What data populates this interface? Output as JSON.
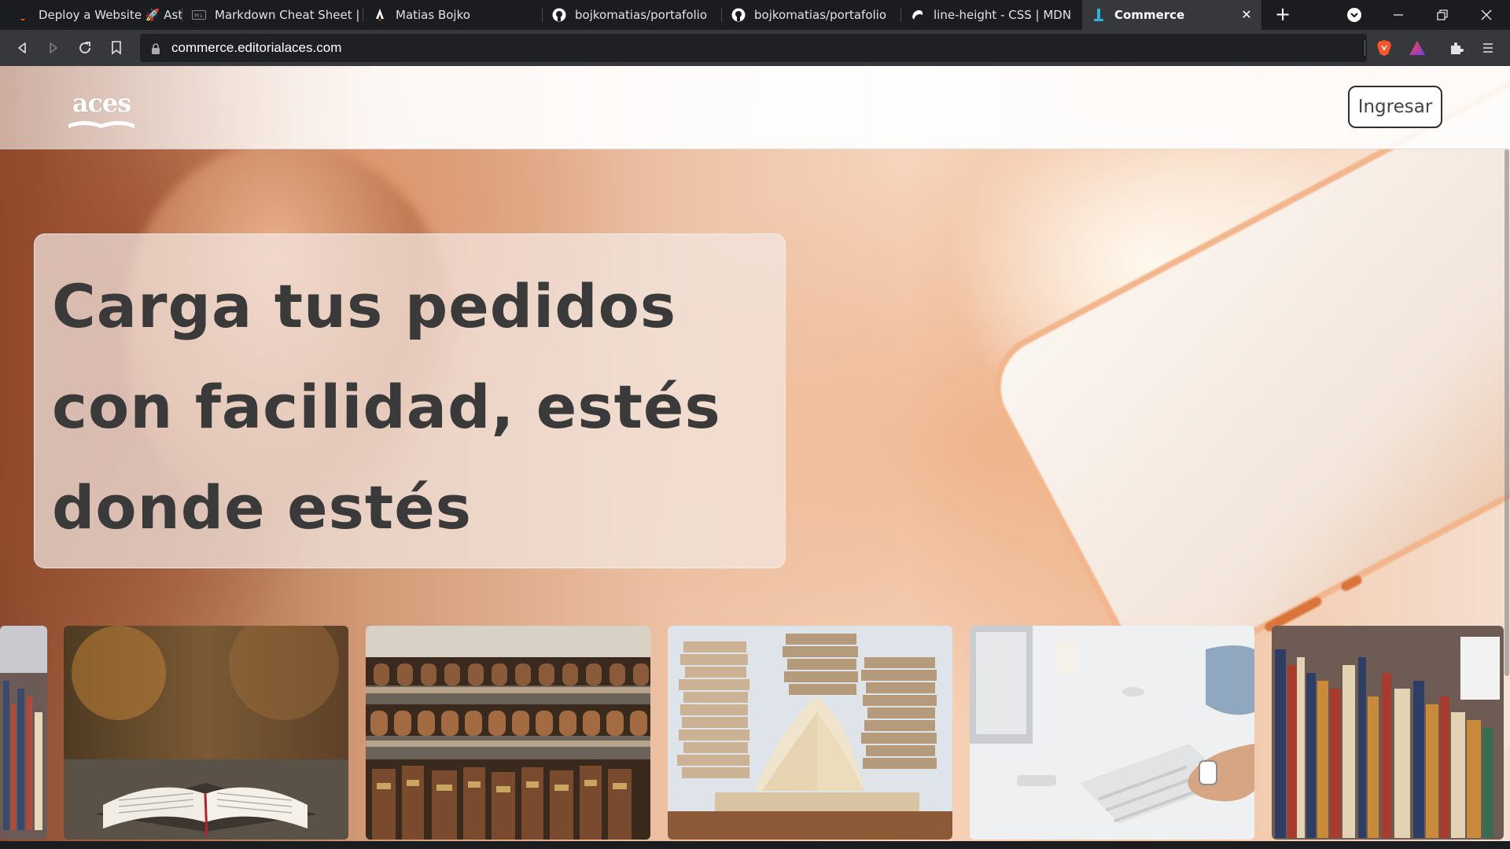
{
  "tabs": [
    {
      "title": "Deploy a Website 🚀 Astro",
      "icon": "astro-icon"
    },
    {
      "title": "Markdown Cheat Sheet | M",
      "icon": "markdown-icon"
    },
    {
      "title": "Matias Bojko",
      "icon": "astro-logo-icon"
    },
    {
      "title": "bojkomatias/portafolio",
      "icon": "github-icon"
    },
    {
      "title": "bojkomatias/portafolio",
      "icon": "github-icon"
    },
    {
      "title": "line-height - CSS | MDN",
      "icon": "mdn-icon"
    },
    {
      "title": "Commerce",
      "icon": "commerce-icon",
      "active": true
    }
  ],
  "address": {
    "url": "commerce.editorialaces.com"
  },
  "page": {
    "logo_text": "aces",
    "login_label": "Ingresar",
    "hero_line1": "Carga tus pedidos",
    "hero_line2": "con facilidad, estés",
    "hero_line3": "donde estés"
  },
  "carousel": [
    {
      "subject": "bookstore-shelves-partial"
    },
    {
      "subject": "open-bible-autumn"
    },
    {
      "subject": "old-book-shelves"
    },
    {
      "subject": "stacked-books-open"
    },
    {
      "subject": "desk-keyboard-hand"
    },
    {
      "subject": "book-stacks-library"
    }
  ],
  "colors": {
    "tab_bg": "#1b1c1f",
    "toolbar_bg": "#37383c",
    "brave_orange": "#fb542b",
    "hero_text": "#3a3a3a"
  }
}
